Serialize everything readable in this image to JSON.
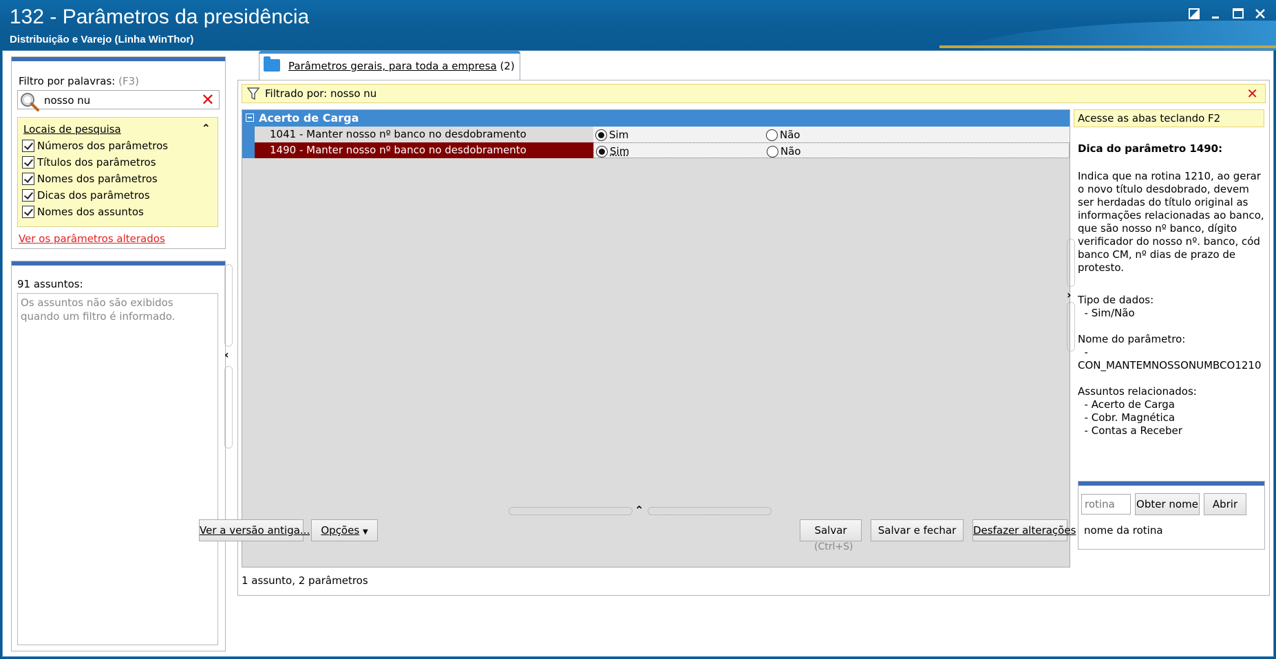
{
  "window": {
    "title": "132 - Parâmetros da presidência",
    "subtitle": "Distribuição e Varejo (Linha WinThor)",
    "controls": [
      "restore-icon",
      "minimize-icon",
      "maximize-icon",
      "close-icon"
    ]
  },
  "filter": {
    "label": "Filtro por palavras:",
    "shortcut": "(F3)",
    "value": "nosso nu",
    "locais_title": "Locais de pesquisa",
    "options": [
      {
        "label": "Números dos parâmetros",
        "checked": true
      },
      {
        "label": "Títulos dos parâmetros",
        "checked": true
      },
      {
        "label": "Nomes dos parâmetros",
        "checked": true
      },
      {
        "label": "Dicas dos parâmetros",
        "checked": true
      },
      {
        "label": "Nomes dos assuntos",
        "checked": true
      }
    ],
    "changed_link": "Ver os parâmetros alterados"
  },
  "subjects": {
    "count_label": "91 assuntos:",
    "empty_message": "Os assuntos não são exibidos quando um filtro é informado."
  },
  "tab": {
    "label": "Parâmetros gerais, para toda a empresa",
    "count": "(2)"
  },
  "filter_bar": {
    "text": "Filtrado por: nosso nu"
  },
  "grid": {
    "group": "Acerto de Carga",
    "rows": [
      {
        "name": "1041 - Manter nosso nº banco no desdobramento",
        "yes": "Sim",
        "no": "Não",
        "selected": "Sim"
      },
      {
        "name": "1490 - Manter nosso nº banco no desdobramento",
        "yes": "Sim",
        "no": "Não",
        "selected": "Sim"
      }
    ],
    "status": "1 assunto, 2 parâmetros"
  },
  "help": {
    "hint": "Acesse as abas teclando F2",
    "title": "Dica do parâmetro 1490:",
    "description": "Indica que na rotina 1210, ao gerar o novo título desdobrado, devem ser herdadas do título original as informações relacionadas ao banco, que são nosso nº banco, dígito verificador do nosso nº. banco, cód banco CM, nº dias de prazo de protesto.",
    "meta": "Tipo de dados:\n  - Sim/Não\n\nNome do parâmetro:\n  -\nCON_MANTEMNOSSONUMBCO1210\n\nAssuntos relacionados:\n  - Acerto de Carga\n  - Cobr. Magnética\n  - Contas a Receber"
  },
  "rotina": {
    "placeholder": "rotina",
    "get_name_button": "Obter nome",
    "open_button": "Abrir",
    "name_label": "nome da rotina"
  },
  "footer": {
    "old_version_button": "Ver a versão antiga...",
    "options_button": "Opções",
    "save_button": "Salvar",
    "save_shortcut": "(Ctrl+S)",
    "save_close_button": "Salvar e fechar",
    "undo_button": "Desfazer alterações"
  },
  "colors": {
    "accent": "#3f8ad0",
    "selected_row": "#800000",
    "highlight": "#fdfbc4"
  }
}
